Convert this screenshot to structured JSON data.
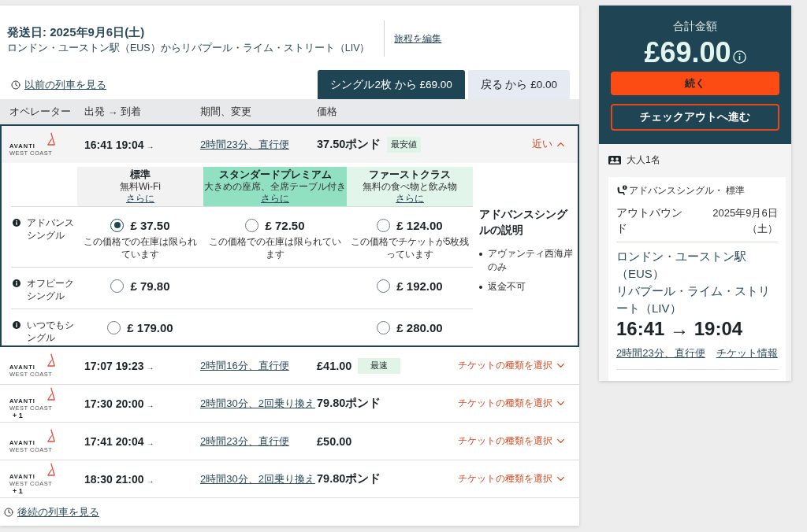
{
  "journey": {
    "title": "発送日: 2025年9月6日(土)",
    "route": "ロンドン・ユーストン駅（EUS）からリバプール・ライム・ストリート（LIV）",
    "edit_link": "旅程を編集"
  },
  "earlier_link": "以前の列車を見る",
  "tabs": [
    {
      "label": "シングル2枚 から £69.00",
      "selected": true
    },
    {
      "label": "戻る から £0.00",
      "selected": false
    }
  ],
  "columns": [
    "オペレーター",
    "出発 → 到着",
    "期間、変更",
    "価格"
  ],
  "trains": [
    {
      "operator": {
        "name": "AVANTI",
        "sub": "WEST COAST"
      },
      "depart": "16:41",
      "arrive": "19:04",
      "arrow": "→",
      "duration": "2時間23分、直行便",
      "price": "37.50ポンド",
      "badge": "最安値",
      "action": "近い",
      "expanded": true,
      "fares": {
        "classes": [
          {
            "name": "標準",
            "feature": "無料Wi-Fi",
            "link": "さらに",
            "color": "#f2f2f2"
          },
          {
            "name": "スタンダードプレミアム",
            "feature": "大きめの座席、全席テーブル付き",
            "link": "さらに",
            "color": "#91e0c2"
          },
          {
            "name": "ファーストクラス",
            "feature": "無料の食べ物と飲み物",
            "link": "さらに",
            "color": "#e1f5eb"
          }
        ],
        "rows": [
          {
            "name": "アドバンスシングル",
            "standard": {
              "price": "£ 37.50",
              "note": "この価格での在庫は限られています",
              "selected": true
            },
            "premium": {
              "price": "£ 72.50",
              "note": "この価格での在庫は限られています",
              "selected": false
            },
            "first_class": {
              "price": "£ 124.00",
              "note": "この価格でチケットが5枚残っています",
              "selected": false
            }
          },
          {
            "name": "オフピークシングル",
            "standard": {
              "price": "£ 79.80",
              "selected": false
            },
            "first_class": {
              "price": "£ 192.00",
              "selected": false
            }
          },
          {
            "name": "いつでもシングル",
            "standard": {
              "price": "£ 179.00",
              "selected": false
            },
            "first_class": {
              "price": "£ 280.00",
              "selected": false
            }
          }
        ],
        "description": {
          "title": "アドバンスシングルの説明",
          "points": [
            "アヴァンティ西海岸のみ",
            "返金不可"
          ]
        }
      }
    },
    {
      "operator": {
        "name": "AVANTI",
        "sub": "WEST COAST"
      },
      "depart": "17:07",
      "arrive": "19:23",
      "arrow": "→",
      "duration": "2時間16分、直行便",
      "price": "£41.00",
      "badge": "最速",
      "action": "チケットの種類を選択",
      "expanded": false
    },
    {
      "operator": {
        "name": "AVANTI",
        "sub": "WEST COAST",
        "extra": "+ 1"
      },
      "depart": "17:30",
      "arrive": "20:00",
      "arrow": "→",
      "duration": "2時間30分、2回乗り換え",
      "price": "79.80ポンド",
      "action": "チケットの種類を選択",
      "expanded": false
    },
    {
      "operator": {
        "name": "AVANTI",
        "sub": "WEST COAST"
      },
      "depart": "17:41",
      "arrive": "20:04",
      "arrow": "→",
      "duration": "2時間23分、直行便",
      "price": "£50.00",
      "action": "チケットの種類を選択",
      "expanded": false
    },
    {
      "operator": {
        "name": "AVANTI",
        "sub": "WEST COAST",
        "extra": "+ 1"
      },
      "depart": "18:30",
      "arrive": "21:00",
      "arrow": "→",
      "duration": "2時間30分、2回乗り換え",
      "price": "79.80ポンド",
      "action": "チケットの種類を選択",
      "expanded": false
    }
  ],
  "later_link": "後続の列車を見る",
  "summary": {
    "title": "合計金額",
    "total": "£69.00",
    "buttons": [
      {
        "label": "続く",
        "kind": "primary"
      },
      {
        "label": "チェックアウトへ進む",
        "kind": "outline"
      }
    ],
    "passengers": "大人1名",
    "ticket": {
      "fare": "アドバンスシングル・ 標準",
      "direction": "アウトバウンド",
      "date": "2025年9月6日（土）",
      "from": "ロンドン・ユーストン駅（EUS）",
      "to": "リバプール・ライム・ストリート（LIV）",
      "times": "16:41 → 19:04",
      "duration": "2時間23分、直行便",
      "info_link": "チケット情報"
    }
  }
}
